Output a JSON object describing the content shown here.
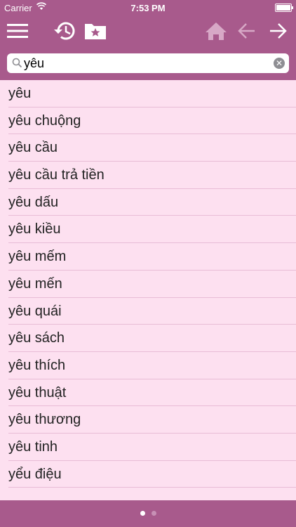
{
  "status_bar": {
    "carrier": "Carrier",
    "time": "7:53 PM"
  },
  "toolbar": {
    "icons": [
      "menu-icon",
      "history-icon",
      "favorites-folder-icon",
      "home-icon",
      "back-arrow-icon",
      "forward-arrow-icon"
    ]
  },
  "search": {
    "value": "yêu",
    "placeholder": ""
  },
  "results": [
    "yêu",
    "yêu chuộng",
    "yêu cầu",
    "yêu cầu trả tiền",
    "yêu dấu",
    "yêu kiều",
    "yêu mếm",
    "yêu mến",
    "yêu quái",
    "yêu sách",
    "yêu thích",
    "yêu thuật",
    "yêu thương",
    "yêu tinh",
    "yểu điệu"
  ],
  "pager": {
    "current_page": 1,
    "page_count": 2
  },
  "colors": {
    "bar": "#a85a8c",
    "list_bg": "#fde0f0",
    "separator": "#e8bcd6"
  }
}
